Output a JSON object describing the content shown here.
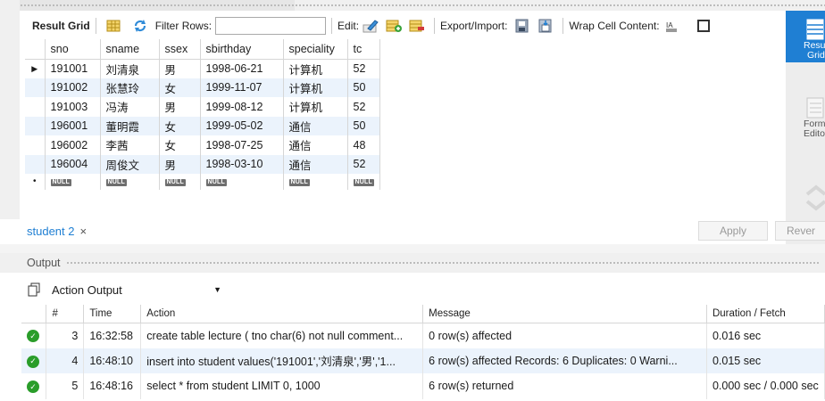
{
  "toolbar": {
    "result_grid": "Result Grid",
    "filter_rows": "Filter Rows:",
    "edit": "Edit:",
    "export_import": "Export/Import:",
    "wrap_cell": "Wrap Cell Content:"
  },
  "grid": {
    "columns": [
      "sno",
      "sname",
      "ssex",
      "sbirthday",
      "speciality",
      "tc"
    ],
    "rows": [
      [
        "191001",
        "刘清泉",
        "男",
        "1998-06-21",
        "计算机",
        "52"
      ],
      [
        "191002",
        "张慧玲",
        "女",
        "1999-11-07",
        "计算机",
        "50"
      ],
      [
        "191003",
        "冯涛",
        "男",
        "1999-08-12",
        "计算机",
        "52"
      ],
      [
        "196001",
        "董明霞",
        "女",
        "1999-05-02",
        "通信",
        "50"
      ],
      [
        "196002",
        "李茜",
        "女",
        "1998-07-25",
        "通信",
        "48"
      ],
      [
        "196004",
        "周俊文",
        "男",
        "1998-03-10",
        "通信",
        "52"
      ]
    ],
    "null_label": "NULL",
    "current_row_marker": "▶",
    "new_row_marker": "•"
  },
  "side_panel": {
    "result_grid_line1": "Resul",
    "result_grid_line2": "Grid",
    "form_editor_line1": "Form",
    "form_editor_line2": "Edito"
  },
  "tab": {
    "label": "student 2",
    "close": "×"
  },
  "buttons": {
    "apply": "Apply",
    "revert": "Rever"
  },
  "output": {
    "title": "Output",
    "selector": "Action Output",
    "columns": [
      "",
      "#",
      "Time",
      "Action",
      "Message",
      "Duration / Fetch"
    ],
    "rows": [
      {
        "num": "3",
        "time": "16:32:58",
        "action": "create table lecture ( tno char(6) not null comment...",
        "message": "0 row(s) affected",
        "duration": "0.016 sec"
      },
      {
        "num": "4",
        "time": "16:48:10",
        "action": "insert into student values('191001','刘清泉','男','1...",
        "message": "6 row(s) affected Records: 6  Duplicates: 0  Warni...",
        "duration": "0.015 sec"
      },
      {
        "num": "5",
        "time": "16:48:16",
        "action": "select * from student LIMIT 0, 1000",
        "message": "6 row(s) returned",
        "duration": "0.000 sec / 0.000 sec"
      }
    ]
  },
  "colors": {
    "accent": "#1f7fd3",
    "row_alt": "#ebf3fc",
    "ok_green": "#2a9d2a"
  }
}
